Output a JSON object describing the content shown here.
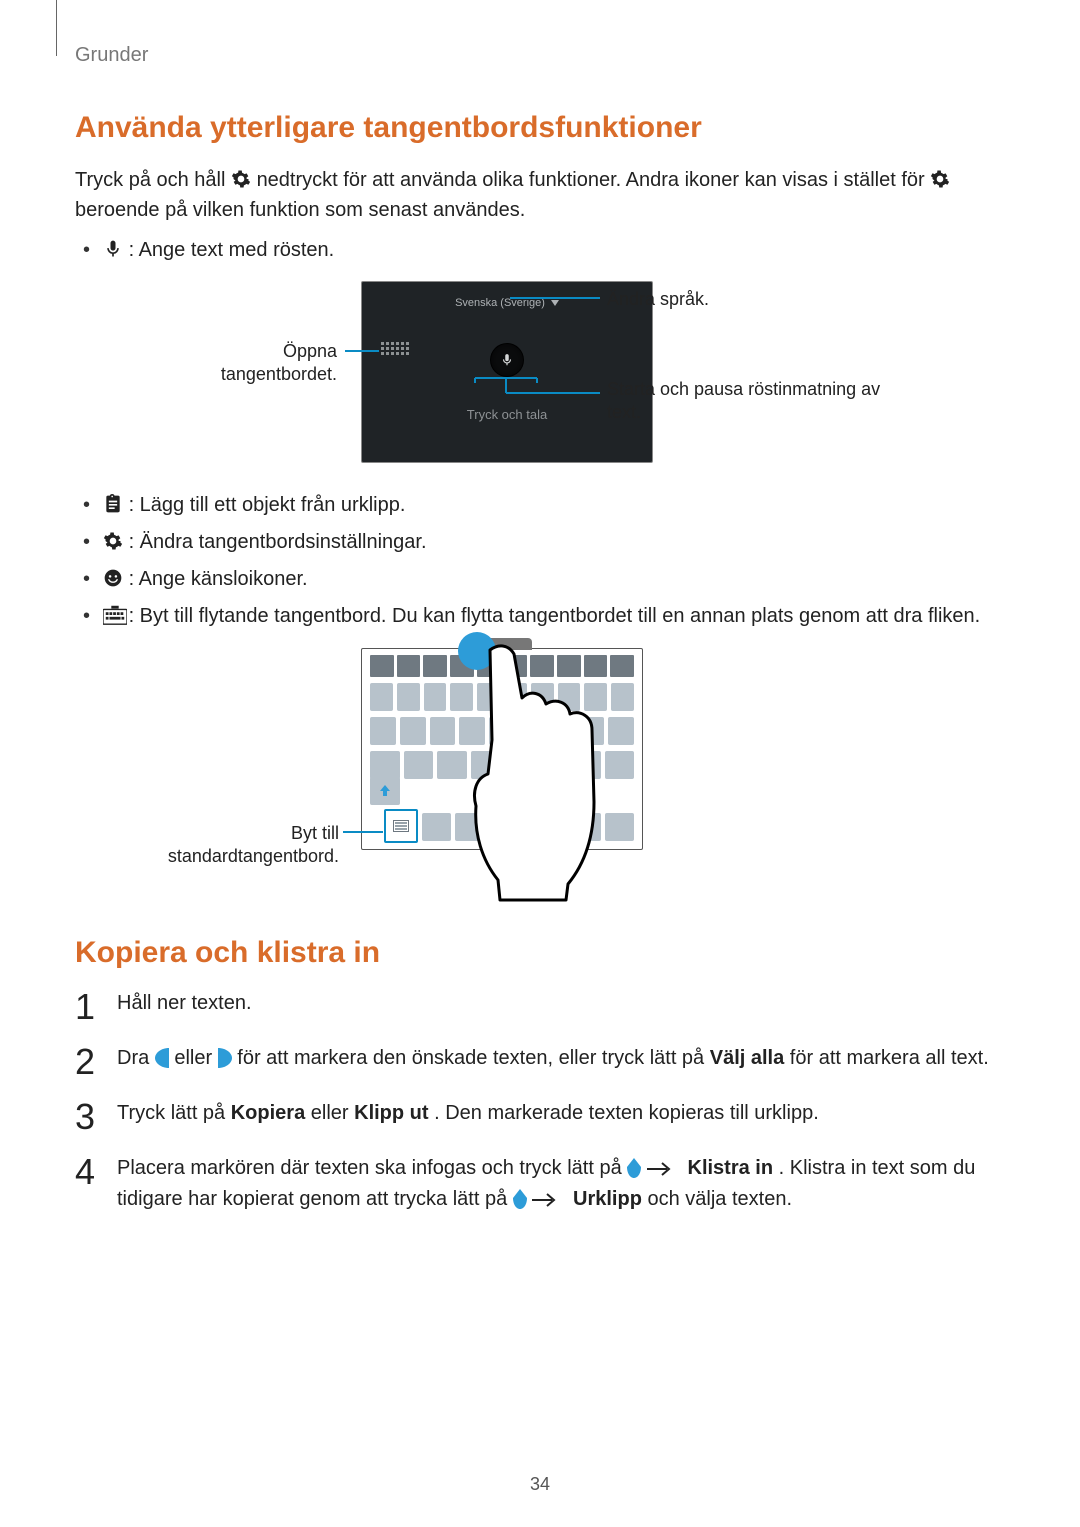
{
  "breadcrumb": "Grunder",
  "page_number": "34",
  "section1": {
    "heading": "Använda ytterligare tangentbordsfunktioner",
    "para_pre_gear": "Tryck på och håll ",
    "para_mid": " nedtryckt för att använda olika funktioner. Andra ikoner kan visas i stället för ",
    "para_post_gear": " beroende på vilken funktion som senast användes.",
    "bullet_mic": " : Ange text med rösten.",
    "fig1": {
      "topbar": "Svenska (Sverige)",
      "talk_label": "Tryck och tala",
      "callout_left": "Öppna tangentbordet.",
      "callout_top_right": "Ändra språk.",
      "callout_bottom_right": "Starta och pausa röstinmatning av text."
    },
    "bullet_clipboard": " : Lägg till ett objekt från urklipp.",
    "bullet_settings": " : Ändra tangentbordsinställningar.",
    "bullet_emoji": " : Ange känsloikoner.",
    "bullet_float": " : Byt till flytande tangentbord. Du kan flytta tangentbordet till en annan plats genom att dra fliken.",
    "fig2": {
      "callout_left": "Byt till standardtangentbord."
    }
  },
  "section2": {
    "heading": "Kopiera och klistra in",
    "step1": "Håll ner texten.",
    "step2_pre": "Dra ",
    "step2_eller": " eller ",
    "step2_mid": " för att markera den önskade texten, eller tryck lätt på ",
    "step2_valjalla": "Välj alla",
    "step2_post": " för att markera all text.",
    "step3_pre": "Tryck lätt på ",
    "step3_kopiera": "Kopiera",
    "step3_eller": " eller ",
    "step3_klipput": "Klipp ut",
    "step3_post": ". Den markerade texten kopieras till urklipp.",
    "step4_pre": "Placera markören där texten ska infogas och tryck lätt på ",
    "step4_arrow": " → ",
    "step4_klistrain": "Klistra in",
    "step4_mid": ". Klistra in text som du tidigare har kopierat genom att trycka lätt på ",
    "step4_arrow2": " → ",
    "step4_urklipp": "Urklipp",
    "step4_post": " och välja texten."
  }
}
